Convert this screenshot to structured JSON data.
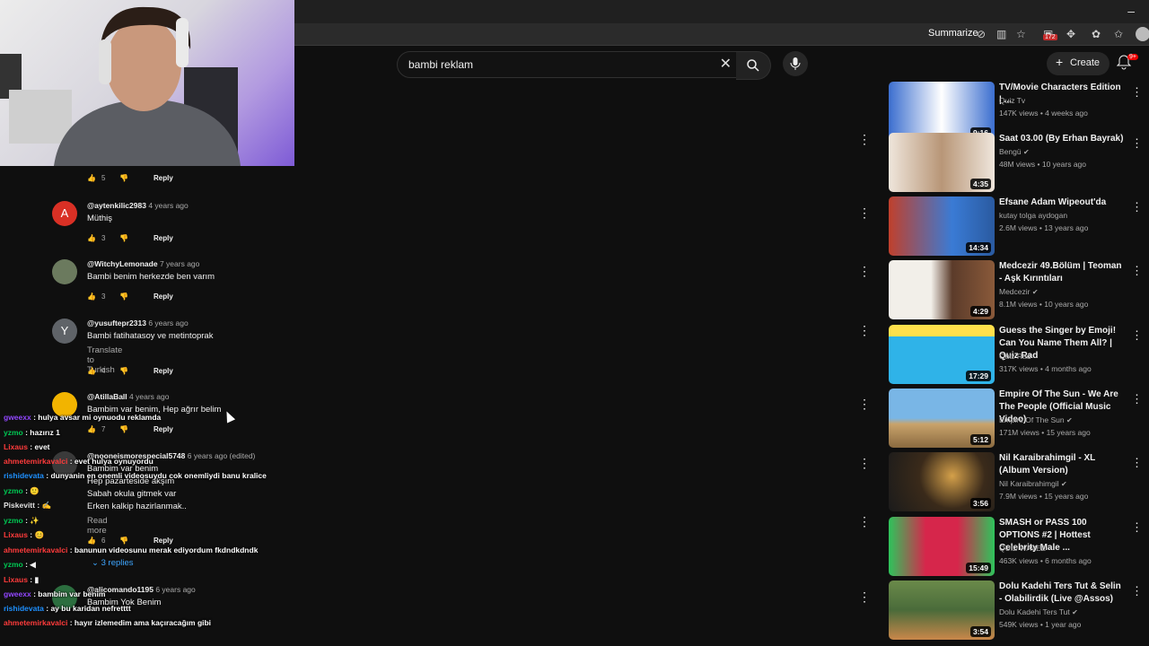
{
  "browser": {
    "summarize_label": "Summarize",
    "extension_badge": "172"
  },
  "header": {
    "search_query": "bambi reklam",
    "create_label": "Create",
    "notifications_badge": "9+"
  },
  "comments": [
    {
      "author": "",
      "time": "",
      "text": "",
      "likes": "5",
      "reply_label": "Reply"
    },
    {
      "author": "@aytenkilic2983",
      "time": "4 years ago",
      "text": "Müthiş",
      "likes": "3",
      "reply_label": "Reply",
      "avatar_letter": "A",
      "avatar_color": "#d93025"
    },
    {
      "author": "@WitchyLemonade",
      "time": "7 years ago",
      "text": "Bambi benim herkezde ben varım",
      "likes": "3",
      "reply_label": "Reply"
    },
    {
      "author": "@yusuftepr2313",
      "time": "6 years ago",
      "text": "Bambi fatihatasoy ve metintoprak",
      "translate": "Translate to Turkish",
      "likes": "4",
      "reply_label": "Reply",
      "avatar_letter": "Y",
      "avatar_color": "#5f6368"
    },
    {
      "author": "@AtillaBall",
      "time": "4 years ago",
      "text": "Bambim var benim, Hep ağrır belim",
      "likes": "7",
      "reply_label": "Reply"
    },
    {
      "author": "@nooneismorespecial5748",
      "time": "6 years ago (edited)",
      "lines": [
        "Bambim var benim",
        "Hep pazarteside akşım",
        "Sabah okula gitmek var",
        "Erken kalkip hazirlanmak.."
      ],
      "read_more": "Read more",
      "likes": "6",
      "reply_label": "Reply",
      "replies_label": "3 replies"
    },
    {
      "author": "@alicomando1195",
      "time": "6 years ago",
      "text": "Bambim Yok Benim"
    }
  ],
  "chat": [
    {
      "user": "gweexx",
      "message": "hulya avsar mi oynuodu reklamda",
      "color": "#9146ff"
    },
    {
      "user": "yzmo",
      "message": "hazırız 1",
      "color": "#00c853"
    },
    {
      "user": "Lixaus",
      "message": "evet",
      "color": "#ff3b3b"
    },
    {
      "user": "ahmetemirkavalci",
      "message": "evet hulya oynuyordu",
      "color": "#ff3b3b"
    },
    {
      "user": "rishidevata",
      "message": "dunyanin en onemli videosuydu cok onemliydi banu kralice",
      "color": "#1e90ff"
    },
    {
      "user": "yzmo",
      "message": "",
      "color": "#00c853"
    },
    {
      "user": "Piskevitt",
      "message": "",
      "color": "#e0e0e0"
    },
    {
      "user": "yzmo",
      "message": "",
      "color": "#00c853"
    },
    {
      "user": "Lixaus",
      "message": "",
      "color": "#ff3b3b"
    },
    {
      "user": "ahmetemirkavalci",
      "message": "banunun videosunu merak ediyordum fkdndkdndk",
      "color": "#ff3b3b"
    },
    {
      "user": "yzmo",
      "message": "",
      "color": "#00c853"
    },
    {
      "user": "Lixaus",
      "message": "",
      "color": "#ff3b3b"
    },
    {
      "user": "gweexx",
      "message": "bambim var benim",
      "color": "#9146ff"
    },
    {
      "user": "rishidevata",
      "message": "ay bu karidan nefretttt",
      "color": "#1e90ff"
    },
    {
      "user": "ahmetemirkavalci",
      "message": "hayır izlemedim ama kaçıracağım gibi",
      "color": "#ff3b3b"
    }
  ],
  "recommendations": [
    {
      "title": "TV/Movie Characters Edition | ...",
      "channel": "Quiz Tv",
      "meta": "147K views • 4 weeks ago",
      "duration": "9:16",
      "colors": [
        "#3b6ecf",
        "#ffffff"
      ]
    },
    {
      "title": "Saat 03.00 (By Erhan Bayrak)",
      "channel": "Bengü",
      "verified": true,
      "meta": "48M views • 10 years ago",
      "duration": "4:35",
      "colors": [
        "#b89677",
        "#efe6dc"
      ]
    },
    {
      "title": "Efsane Adam Wipeout'da",
      "channel": "kutay tolga aydogan",
      "meta": "2.6M views • 13 years ago",
      "duration": "14:34",
      "colors": [
        "#3a7bd5",
        "#c0402c"
      ]
    },
    {
      "title": "Medcezir 49.Bölüm | Teoman - Aşk Kırıntıları",
      "channel": "Medcezir",
      "verified": true,
      "meta": "8.1M views • 10 years ago",
      "duration": "4:29",
      "colors": [
        "#f2efe9",
        "#5b3b2a"
      ]
    },
    {
      "title": "Guess the Singer by Emoji! Can You Name Them All? | Quiz Rad",
      "channel": "Quiz Rad",
      "meta": "317K views • 4 months ago",
      "duration": "17:29",
      "colors": [
        "#2fb3e8",
        "#ffe04b"
      ]
    },
    {
      "title": "Empire Of The Sun - We Are The People (Official Music Video)",
      "channel": "Empire Of The Sun",
      "verified": true,
      "meta": "171M views • 15 years ago",
      "duration": "5:12",
      "colors": [
        "#79b6e6",
        "#c9a36b"
      ]
    },
    {
      "title": "Nil Karaibrahimgil - XL (Album Version)",
      "channel": "Nil Karaibrahimgil",
      "verified": true,
      "meta": "7.9M views • 15 years ago",
      "duration": "3:56",
      "colors": [
        "#1b1b1b",
        "#d4a04a"
      ]
    },
    {
      "title": "SMASH or PASS 100 OPTIONS #2 | Hottest Celebrity Male ...",
      "channel": "QUIZ WAVEZ",
      "meta": "463K views • 6 months ago",
      "duration": "15:49",
      "colors": [
        "#d6264b",
        "#2ec45b"
      ]
    },
    {
      "title": "Dolu Kadehi Ters Tut & Selin - Olabilirdik (Live @Assos)",
      "channel": "Dolu Kadehi Ters Tut",
      "verified": true,
      "meta": "549K views • 1 year ago",
      "duration": "3:54",
      "colors": [
        "#4a6b3a",
        "#c9874a"
      ]
    }
  ],
  "icons": {
    "search": "search-icon",
    "clear": "close-icon",
    "mic": "mic-icon",
    "bell": "bell-icon",
    "like": "thumb-up-icon",
    "dislike": "thumb-down-icon",
    "menu": "more-vert-icon"
  }
}
